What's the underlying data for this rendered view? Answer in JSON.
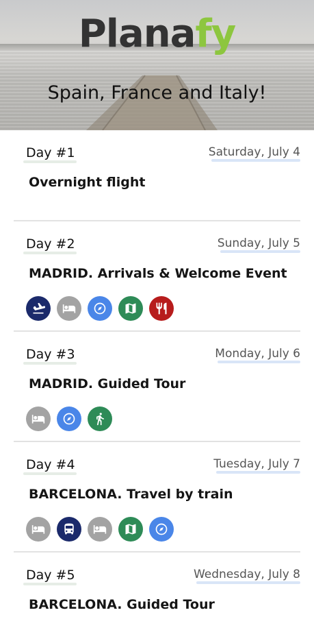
{
  "header": {
    "logo_part1": "Plana",
    "logo_part2": "fy",
    "tagline": "Spain, France and Italy!"
  },
  "days": [
    {
      "num": "Day #1",
      "date": "Saturday, July 4",
      "title": "Overnight flight",
      "icons": []
    },
    {
      "num": "Day #2",
      "date": "Sunday, July 5",
      "title": "MADRID. Arrivals & Welcome Event",
      "icons": [
        "flight-landing-icon",
        "bed-icon",
        "compass-icon",
        "map-icon",
        "restaurant-icon"
      ]
    },
    {
      "num": "Day #3",
      "date": "Monday, July 6",
      "title": "MADRID. Guided Tour",
      "icons": [
        "bed-icon",
        "compass-icon",
        "walking-icon"
      ]
    },
    {
      "num": "Day #4",
      "date": "Tuesday, July 7",
      "title": "BARCELONA. Travel by train",
      "icons": [
        "bed-icon",
        "bus-icon",
        "bed-icon",
        "map-icon",
        "compass-icon"
      ]
    },
    {
      "num": "Day #5",
      "date": "Wednesday, July 8",
      "title": "BARCELONA. Guided Tour",
      "icons": []
    }
  ],
  "colors": {
    "brand_green": "#8dc63f",
    "navy": "#1b2a6b",
    "gray": "#a3a3a3",
    "blue": "#4a86e8",
    "green": "#2e8b57",
    "red": "#b71c1c"
  }
}
